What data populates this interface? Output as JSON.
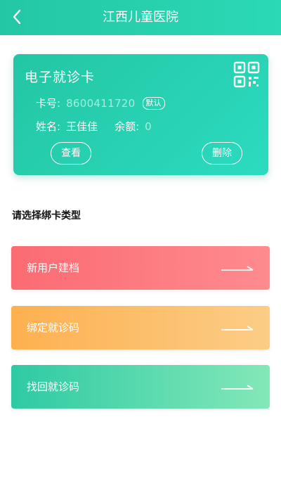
{
  "header": {
    "title": "江西儿童医院"
  },
  "card": {
    "title": "电子就诊卡",
    "number_label": "卡号:",
    "number_value": "8600411720",
    "default_badge": "默认",
    "name_label": "姓名:",
    "name_value": "王佳佳",
    "balance_label": "余额:",
    "balance_value": "0",
    "view_button": "查看",
    "delete_button": "删除"
  },
  "section": {
    "title": "请选择绑卡类型"
  },
  "options": [
    {
      "label": "新用户建档",
      "color": "#fb6b72"
    },
    {
      "label": "绑定就诊码",
      "color": "#fdb04f"
    },
    {
      "label": "找回就诊码",
      "color": "#2ecaa4"
    }
  ]
}
